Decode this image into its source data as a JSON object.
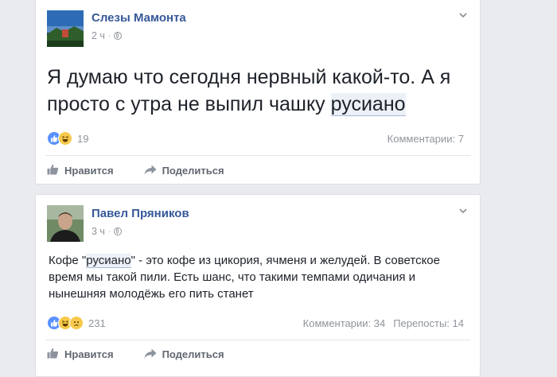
{
  "posts": [
    {
      "author": "Слезы Мамонта",
      "time": "2 ч",
      "text_before": "Я думаю что сегодня нервный какой-то. А я просто с утра не выпил чашку ",
      "text_highlight": "русиано",
      "text_after": "",
      "reaction_count": "19",
      "stats": [
        "Комментарии: 7"
      ],
      "actions": {
        "like": "Нравится",
        "share": "Поделиться"
      }
    },
    {
      "author": "Павел Пряников",
      "time": "3 ч",
      "text_before": "Кофе \"",
      "text_highlight": "русиано",
      "text_after": "\" - это кофе из цикория, ячменя и желудей. В советское время мы такой пили. Есть шанс, что такими темпами одичания и нынешняя молодёжь его пить станет",
      "reaction_count": "231",
      "stats": [
        "Комментарии: 34",
        "Перепосты: 14"
      ],
      "actions": {
        "like": "Нравится",
        "share": "Поделиться"
      }
    }
  ],
  "colors": {
    "link": "#365899",
    "like_blue": "#5890ff",
    "emoji_yellow": "#f7c94b",
    "muted": "#90949c"
  },
  "icons": [
    "globe-icon",
    "chevron-down-icon",
    "like-reaction-icon",
    "haha-reaction-icon",
    "sad-reaction-icon",
    "thumbs-up-icon",
    "share-arrow-icon"
  ]
}
